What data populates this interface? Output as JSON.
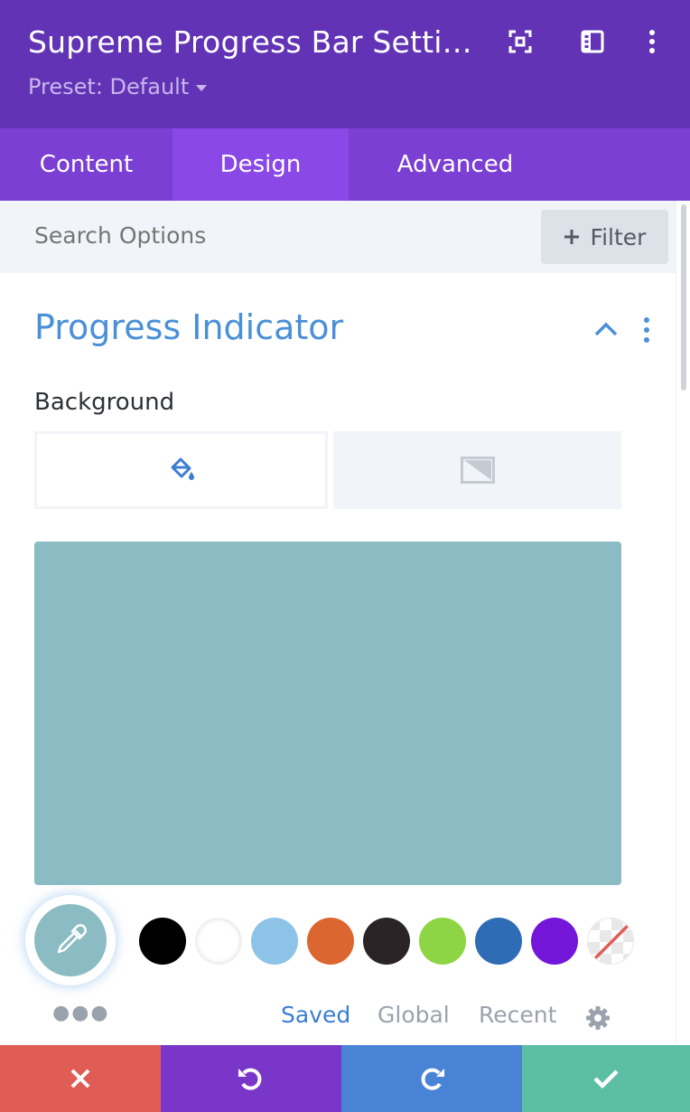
{
  "header": {
    "title": "Supreme Progress Bar Setti…",
    "preset": "Preset: Default",
    "bg_color": "#6234b5"
  },
  "tabs": [
    {
      "label": "Content",
      "active": false
    },
    {
      "label": "Design",
      "active": true
    },
    {
      "label": "Advanced",
      "active": false
    }
  ],
  "search": {
    "placeholder": "Search Options",
    "filter_label": "Filter"
  },
  "section": {
    "title": "Progress Indicator",
    "background_label": "Background",
    "bg_tabs": [
      "paint-bucket-icon",
      "gradient-icon"
    ]
  },
  "color": {
    "selected": "#8cbcc3",
    "swatches": [
      "#000000",
      "#ffffff",
      "#8cc3e6",
      "#dc6630",
      "#2b2426",
      "#8ed546",
      "#2f6cb6",
      "#7416d9",
      "none"
    ]
  },
  "palette_tabs": {
    "saved": "Saved",
    "global": "Global",
    "recent": "Recent",
    "active": "Saved"
  },
  "footer": {
    "cancel_color": "#e05d55",
    "undo_color": "#7a36c8",
    "redo_color": "#4883d6",
    "save_color": "#5cbfa5"
  }
}
